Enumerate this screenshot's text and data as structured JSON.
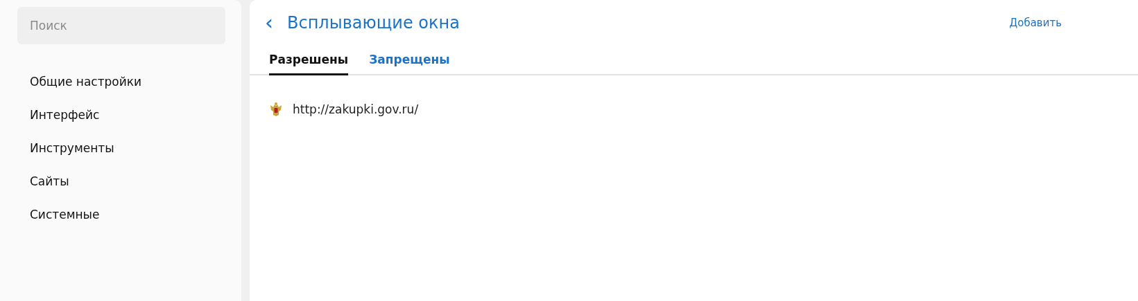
{
  "search": {
    "placeholder": "Поиск"
  },
  "sidebar": {
    "items": [
      {
        "label": "Общие настройки"
      },
      {
        "label": "Интерфейс"
      },
      {
        "label": "Инструменты"
      },
      {
        "label": "Сайты"
      },
      {
        "label": "Системные"
      }
    ]
  },
  "header": {
    "back": "‹",
    "title": "Всплывающие окна",
    "action": "Добавить"
  },
  "tabs": [
    {
      "label": "Разрешены",
      "selected": true
    },
    {
      "label": "Запрещены",
      "selected": false
    }
  ],
  "sites": [
    {
      "url": "http://zakupki.gov.ru/"
    }
  ]
}
